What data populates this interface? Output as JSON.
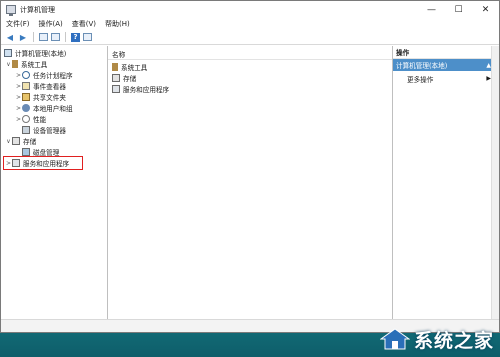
{
  "window": {
    "title": "计算机管理",
    "controls": {
      "minimize": "—",
      "maximize": "☐",
      "close": "✕"
    }
  },
  "menu": [
    "文件(F)",
    "操作(A)",
    "查看(V)",
    "帮助(H)"
  ],
  "tree": {
    "root": "计算机管理(本地)",
    "items": [
      {
        "label": "系统工具",
        "icon": "tools-icon",
        "expander": "∨"
      },
      {
        "label": "任务计划程序",
        "icon": "clock-icon",
        "expander": ">"
      },
      {
        "label": "事件查看器",
        "icon": "log-icon",
        "expander": ">"
      },
      {
        "label": "共享文件夹",
        "icon": "shared-folder-icon",
        "expander": ">"
      },
      {
        "label": "本地用户和组",
        "icon": "users-icon",
        "expander": ">"
      },
      {
        "label": "性能",
        "icon": "performance-icon",
        "expander": ">"
      },
      {
        "label": "设备管理器",
        "icon": "device-manager-icon",
        "expander": ""
      },
      {
        "label": "存储",
        "icon": "storage-icon",
        "expander": "∨"
      },
      {
        "label": "磁盘管理",
        "icon": "disk-icon",
        "expander": ""
      },
      {
        "label": "服务和应用程序",
        "icon": "services-icon",
        "expander": ">"
      }
    ]
  },
  "list": {
    "column": "名称",
    "items": [
      "系统工具",
      "存储",
      "服务和应用程序"
    ]
  },
  "actions": {
    "header": "操作",
    "selected": "计算机管理(本地)",
    "more": "更多操作"
  },
  "watermark": "系统之家",
  "colors": {
    "selection": "#4d8fc9",
    "highlight_box": "#e02020"
  }
}
